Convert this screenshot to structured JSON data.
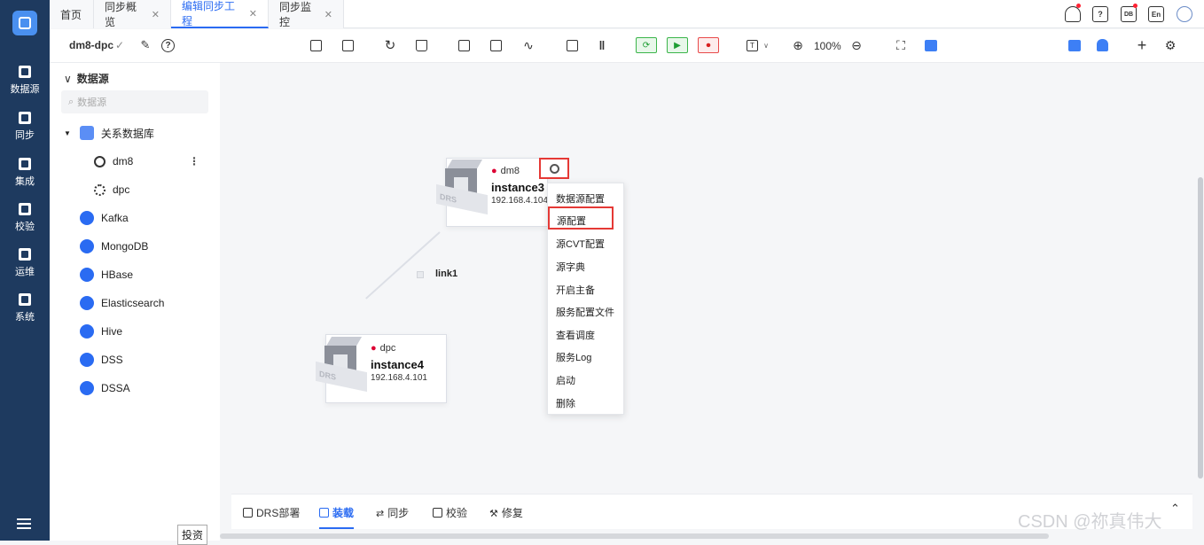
{
  "nav": {
    "items": [
      {
        "label": "数据源",
        "icon": "datasource-icon"
      },
      {
        "label": "同步",
        "icon": "sync-icon"
      },
      {
        "label": "集成",
        "icon": "integration-icon"
      },
      {
        "label": "校验",
        "icon": "check-icon"
      },
      {
        "label": "运维",
        "icon": "ops-icon"
      },
      {
        "label": "系统",
        "icon": "system-icon"
      }
    ]
  },
  "tabs": [
    {
      "label": "首页"
    },
    {
      "label": "同步概览"
    },
    {
      "label": "编辑同步工程"
    },
    {
      "label": "同步监控"
    }
  ],
  "header_icons": {
    "lang": "En",
    "dict": "DB",
    "help": "?"
  },
  "toolbar": {
    "project": "dm8-dpc",
    "zoom": "100%"
  },
  "sidebar": {
    "title": "数据源",
    "search_placeholder": "数据源",
    "tree": [
      {
        "label": "关系数据库"
      },
      {
        "label": "dm8"
      },
      {
        "label": "dpc"
      },
      {
        "label": "Kafka"
      },
      {
        "label": "MongoDB"
      },
      {
        "label": "HBase"
      },
      {
        "label": "Elasticsearch"
      },
      {
        "label": "Hive"
      },
      {
        "label": "DSS"
      },
      {
        "label": "DSSA"
      }
    ]
  },
  "canvas": {
    "node1": {
      "type": "dm8",
      "name": "instance3",
      "ip": "192.168.4.104",
      "badge": "DRS"
    },
    "node2": {
      "type": "dpc",
      "name": "instance4",
      "ip": "192.168.4.101",
      "badge": "DRS"
    },
    "link": "link1"
  },
  "context_menu": [
    "数据源配置",
    "源配置",
    "源CVT配置",
    "源字典",
    "开启主备",
    "服务配置文件",
    "查看调度",
    "服务Log",
    "启动",
    "删除"
  ],
  "bottom_tabs": [
    {
      "label": "DRS部署"
    },
    {
      "label": "装载"
    },
    {
      "label": "同步"
    },
    {
      "label": "校验"
    },
    {
      "label": "修复"
    }
  ],
  "tooltip": "投资",
  "watermark": "CSDN @祢真伟大",
  "colors": {
    "accent": "#2a6bf2",
    "nav_bg": "#1e3a5f",
    "highlight": "#e53935"
  }
}
